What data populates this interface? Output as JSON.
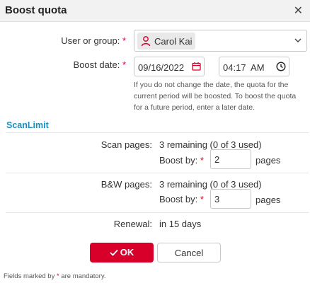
{
  "dialog": {
    "title": "Boost quota",
    "close_icon": "close-icon"
  },
  "form": {
    "user_label": "User or group:",
    "user_value": "Carol Kai",
    "date_label": "Boost date:",
    "date_value": "09/16/2022",
    "time_value": "04:17  AM",
    "help_text": "If you do not change the date, the quota for the current period will be boosted. To boost the quota for a future period, enter a later date.",
    "required_mark": "*"
  },
  "scanlimit": {
    "section_title": "ScanLimit",
    "scan_label": "Scan pages:",
    "scan_remaining": "3 remaining (0 of 3 used)",
    "scan_boost_label": "Boost by:",
    "scan_boost_value": "2",
    "scan_unit": "pages",
    "bw_label": "B&W pages:",
    "bw_remaining": "3 remaining (0 of 3 used)",
    "bw_boost_label": "Boost by:",
    "bw_boost_value": "3",
    "bw_unit": "pages",
    "renewal_label": "Renewal:",
    "renewal_value": "in 15 days"
  },
  "buttons": {
    "ok_label": "OK",
    "cancel_label": "Cancel"
  },
  "footer": {
    "text_before": "Fields marked by ",
    "mark": "*",
    "text_after": " are mandatory."
  },
  "colors": {
    "accent": "#d8002a",
    "link": "#1a8fbf"
  }
}
